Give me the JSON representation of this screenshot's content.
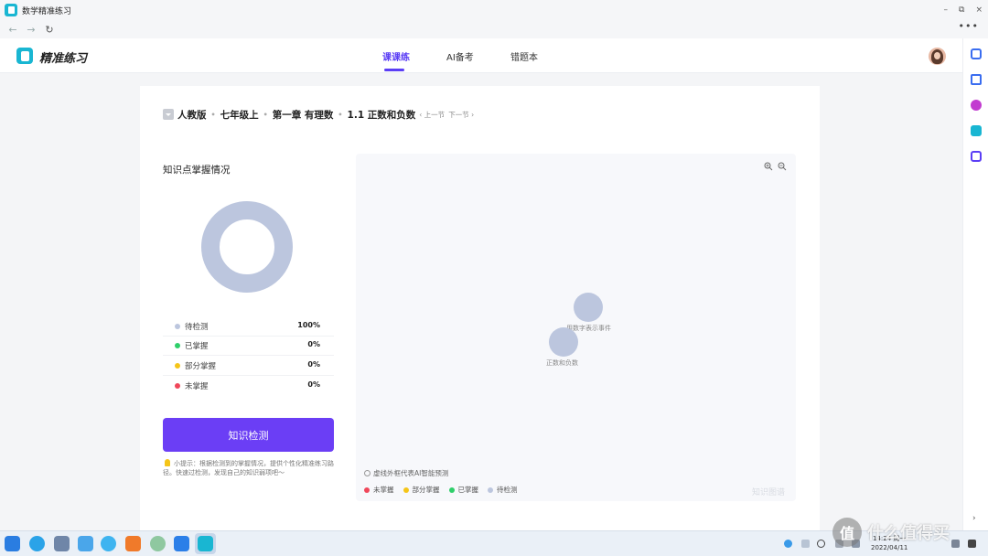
{
  "window": {
    "title": "数学精准练习",
    "controls": [
      "–",
      "⧉",
      "×"
    ]
  },
  "nav": {
    "back": "←",
    "forward": "→",
    "reload": "↻",
    "more": "•••"
  },
  "header": {
    "brand": "精准练习",
    "tabs": [
      {
        "label": "课课练",
        "active": true
      },
      {
        "label": "AI备考",
        "active": false
      },
      {
        "label": "错题本",
        "active": false
      }
    ]
  },
  "breadcrumb": {
    "items": [
      "人教版",
      "七年级上",
      "第一章 有理数",
      "1.1 正数和负数"
    ],
    "prev": "‹ 上一节",
    "next": "下一节 ›"
  },
  "mastery": {
    "title": "知识点掌握情况",
    "donut_fraction_pending": 1.0,
    "legend": [
      {
        "label": "待检测",
        "percent": "100%",
        "color": "#bcc6de"
      },
      {
        "label": "已掌握",
        "percent": "0%",
        "color": "#2fcf6a"
      },
      {
        "label": "部分掌握",
        "percent": "0%",
        "color": "#f5c518"
      },
      {
        "label": "未掌握",
        "percent": "0%",
        "color": "#f0475a"
      }
    ],
    "button": "知识检测",
    "tip": "小提示：根据检测到的掌握情况，提供个性化精准练习路径。快速过检测，发现自己的知识弱项吧～"
  },
  "graph": {
    "nodes": [
      {
        "label": "用数字表示事件"
      },
      {
        "label": "正数和负数"
      }
    ],
    "note": "虚线外框代表AI智能预测",
    "legend": [
      {
        "label": "未掌握",
        "color": "#f0475a"
      },
      {
        "label": "部分掌握",
        "color": "#f5c518"
      },
      {
        "label": "已掌握",
        "color": "#2fcf6a"
      },
      {
        "label": "待检测",
        "color": "#bcc6de"
      }
    ],
    "watermark": "知识图谱"
  },
  "taskbar": {
    "time": "14:24 周一",
    "date": "2022/04/11"
  },
  "watermark_overlay": {
    "text": "什么值得买",
    "logo": "值"
  }
}
